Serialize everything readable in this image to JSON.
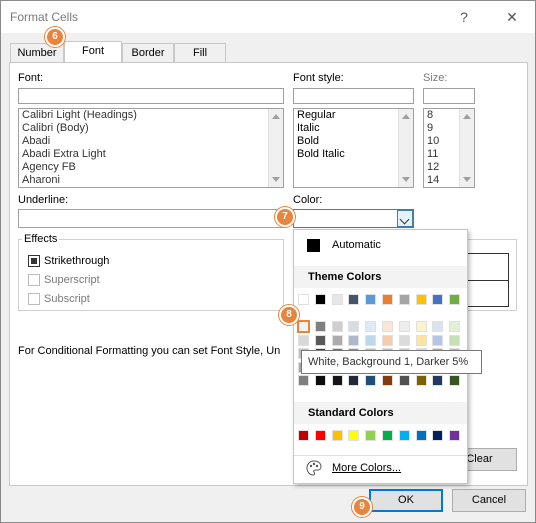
{
  "window": {
    "title": "Format Cells",
    "help_label": "?",
    "close_label": "✕"
  },
  "tabs": [
    {
      "label": "Number"
    },
    {
      "label": "Font"
    },
    {
      "label": "Border"
    },
    {
      "label": "Fill"
    }
  ],
  "font": {
    "label": "Font:",
    "value": "",
    "items": [
      "Calibri Light (Headings)",
      "Calibri (Body)",
      "Abadi",
      "Abadi Extra Light",
      "Agency FB",
      "Aharoni"
    ]
  },
  "font_style": {
    "label": "Font style:",
    "value": "",
    "items": [
      "Regular",
      "Italic",
      "Bold",
      "Bold Italic"
    ]
  },
  "size": {
    "label": "Size:",
    "value": "",
    "items": [
      "8",
      "9",
      "10",
      "11",
      "12",
      "14"
    ]
  },
  "underline": {
    "label": "Underline:",
    "value": ""
  },
  "color": {
    "label": "Color:"
  },
  "effects": {
    "title": "Effects",
    "strikethrough": "Strikethrough",
    "superscript": "Superscript",
    "subscript": "Subscript"
  },
  "info_text": "For Conditional Formatting you can set Font Style, Un",
  "color_popup": {
    "automatic": "Automatic",
    "theme_colors": "Theme Colors",
    "standard_colors": "Standard Colors",
    "more_colors": "More Colors...",
    "theme_top": [
      "#ffffff",
      "#000000",
      "#e7e6e6",
      "#44546a",
      "#5b9bd5",
      "#ed7d31",
      "#a5a5a5",
      "#ffc000",
      "#4472c4",
      "#70ad47"
    ],
    "theme_shades": [
      [
        "#f2f2f2",
        "#7f7f7f",
        "#d0cece",
        "#d6dce4",
        "#deebf6",
        "#fbe5d5",
        "#ededed",
        "#fff2cc",
        "#dae3f3",
        "#e2efd9"
      ],
      [
        "#d8d8d8",
        "#595959",
        "#aeabab",
        "#adb9ca",
        "#bdd7ee",
        "#f7cbac",
        "#dbdbdb",
        "#fee599",
        "#b4c6e7",
        "#c5e0b3"
      ],
      [
        "#bfbfbf",
        "#3f3f3f",
        "#757070",
        "#8496b0",
        "#9dc3e6",
        "#f4b183",
        "#c9c9c9",
        "#ffd965",
        "#8eaadb",
        "#a8d08d"
      ],
      [
        "#a5a5a5",
        "#262626",
        "#3a3838",
        "#323f4f",
        "#2e75b5",
        "#c55a11",
        "#7b7b7b",
        "#bf9000",
        "#2f5496",
        "#538135"
      ],
      [
        "#7f7f7f",
        "#0c0c0c",
        "#171616",
        "#222a35",
        "#1e4e79",
        "#843c0b",
        "#525252",
        "#7f6000",
        "#1f3864",
        "#375623"
      ]
    ],
    "standard": [
      "#c00000",
      "#ff0000",
      "#ffc000",
      "#ffff00",
      "#92d050",
      "#00b050",
      "#00b0f0",
      "#0070c0",
      "#002060",
      "#7030a0"
    ]
  },
  "tooltip": "White, Background 1, Darker 5%",
  "buttons": {
    "clear": "Clear",
    "ok": "OK",
    "cancel": "Cancel"
  },
  "badges": {
    "b6": "6",
    "b7": "7",
    "b8": "8",
    "b9": "9"
  },
  "colors": {
    "accent": "#0078d7",
    "badge": "#e8843c"
  }
}
